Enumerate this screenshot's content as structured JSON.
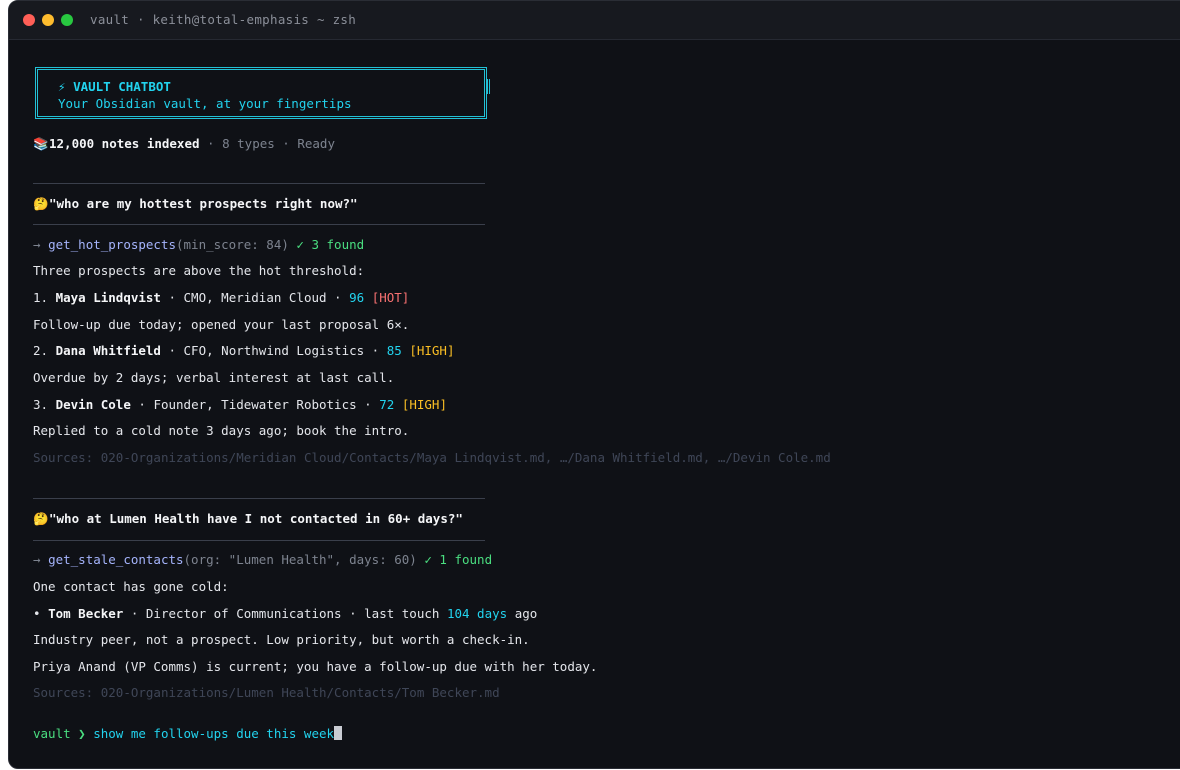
{
  "window": {
    "title": "vault · keith@total-emphasis ~ zsh"
  },
  "banner": {
    "icon": "⚡",
    "title": "VAULT CHATBOT",
    "subtitle": "Your Obsidian vault, at your fingertips"
  },
  "stats": {
    "icon": "📚",
    "notes": "12,000 notes indexed",
    "types": "· 8 types · Ready"
  },
  "conversation": [
    {
      "question_icon": "🤔",
      "question": "\"who are my hottest prospects right now?\"",
      "tool_arrow": "→",
      "tool_name": "get_hot_prospects",
      "tool_args": "(min_score: 84)",
      "tool_result": "✓ 3 found",
      "intro": "Three prospects are above the hot threshold:",
      "items": [
        {
          "num": "1.",
          "name": "Maya Lindqvist",
          "role": "· CMO, Meridian Cloud ·",
          "score": "96",
          "tag": "[HOT]",
          "note": "Follow-up due today; opened your last proposal 6×."
        },
        {
          "num": "2.",
          "name": "Dana Whitfield",
          "role": "· CFO, Northwind Logistics ·",
          "score": "85",
          "tag": "[HIGH]",
          "note": "Overdue by 2 days; verbal interest at last call."
        },
        {
          "num": "3.",
          "name": "Devin Cole",
          "role": "· Founder, Tidewater Robotics ·",
          "score": "72",
          "tag": "[HIGH]",
          "note": "Replied to a cold note 3 days ago; book the intro."
        }
      ],
      "sources_label": "Sources:",
      "sources": "020-Organizations/Meridian Cloud/Contacts/Maya Lindqvist.md, …/Dana Whitfield.md, …/Devin Cole.md"
    },
    {
      "question_icon": "🤔",
      "question": "\"who at Lumen Health have I not contacted in 60+ days?\"",
      "tool_arrow": "→",
      "tool_name": "get_stale_contacts",
      "tool_args": "(org: \"Lumen Health\", days: 60)",
      "tool_result": "✓ 1 found",
      "intro": "One contact has gone cold:",
      "contact": {
        "bullet": "•",
        "name": "Tom Becker",
        "role": "· Director of Communications · last touch",
        "days": "104 days",
        "suffix": "ago"
      },
      "notes": [
        "Industry peer, not a prospect. Low priority, but worth a check-in.",
        "Priya Anand (VP Comms) is current; you have a follow-up due with her today."
      ],
      "sources_label": "Sources:",
      "sources": "020-Organizations/Lumen Health/Contacts/Tom Becker.md"
    }
  ],
  "prompt": {
    "name": "vault ❯",
    "input": "show me follow-ups due this week"
  }
}
